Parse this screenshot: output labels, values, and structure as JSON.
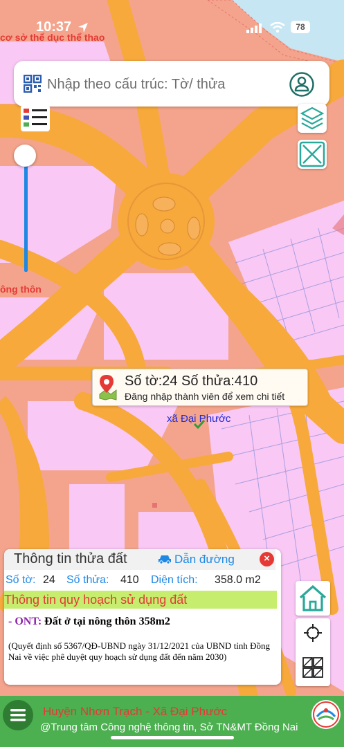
{
  "status_bar": {
    "time": "10:37",
    "battery": "78"
  },
  "search": {
    "placeholder": "Nhập theo cấu trúc: Tờ/ thửa"
  },
  "map_labels": {
    "top_left": "cơ sở thể dục thể thao",
    "left": "ông thôn",
    "commune": "xã Đại Phước"
  },
  "tooltip": {
    "title": "Số tờ:24 Số thửa:410",
    "subtitle": "Đăng nhập thành viên để xem chi tiết"
  },
  "panel": {
    "title": "Thông tin thửa đất",
    "route_label": "Dẫn đường",
    "sheet_label": "Số tờ:",
    "sheet_value": "24",
    "parcel_label": "Số thửa:",
    "parcel_value": "410",
    "area_label": "Diện tích:",
    "area_value": "358.0 m2",
    "plan_header": "Thông tin quy hoạch sử dụng đất",
    "land_code": "- ONT:",
    "land_desc": "Đất ở tại nông thôn 358m2",
    "decision": "(Quyết định số 5367/QĐ-UBND ngày 31/12/2021 của UBND tỉnh Đồng Nai về việc phê duyệt quy hoạch sử dụng đất đến năm 2030)"
  },
  "opacity_slider": {
    "level": 1.0
  },
  "bottom_bar": {
    "location": "Huyện Nhơn Trạch - Xã Đại Phước",
    "credit": "@Trung tâm Công nghệ thông tin, Sở TN&MT Đồng Nai"
  },
  "colors": {
    "road": "#f7a93b",
    "residential": "#f9c8f5",
    "urban": "#f4a48c",
    "water": "#c7e6f4",
    "accent": "#1e88e5",
    "plan_bar": "#c6ed6e",
    "bottom_bar": "#4caf50"
  },
  "icons": [
    "qr-code-icon",
    "account-icon",
    "legend-icon",
    "layers-icon",
    "measure-icon",
    "location-pin-icon",
    "checkmark-icon",
    "car-icon",
    "close-icon",
    "home-icon",
    "crosshair-icon",
    "parcels-icon",
    "menu-icon",
    "app-logo"
  ]
}
